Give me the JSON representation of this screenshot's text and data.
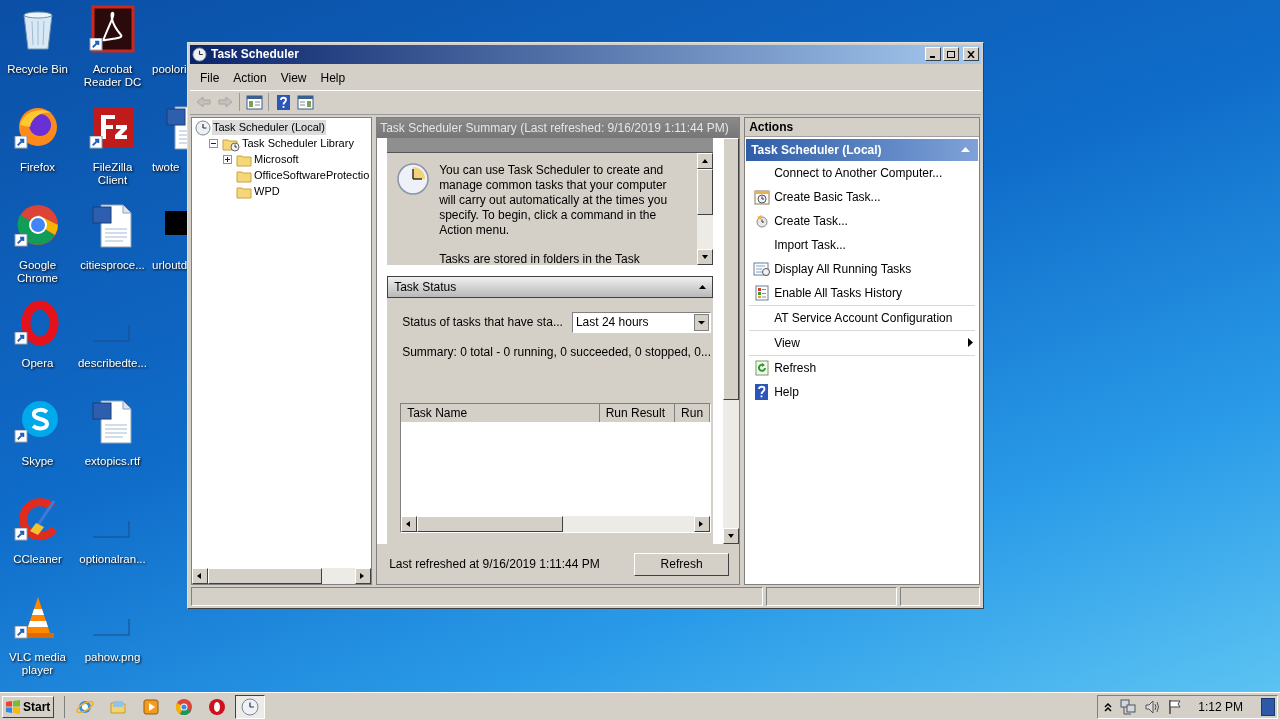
{
  "desktop": {
    "columns": [
      {
        "icons": [
          {
            "label": "Recycle Bin",
            "kind": "recycle-bin",
            "shortcut": false
          },
          {
            "label": "Firefox",
            "kind": "firefox",
            "shortcut": true
          },
          {
            "label": "Google Chrome",
            "kind": "chrome",
            "shortcut": true
          },
          {
            "label": "Opera",
            "kind": "opera",
            "shortcut": true
          },
          {
            "label": "Skype",
            "kind": "skype",
            "shortcut": true
          },
          {
            "label": "CCleaner",
            "kind": "ccleaner",
            "shortcut": true
          },
          {
            "label": "VLC media player",
            "kind": "vlc",
            "shortcut": true
          }
        ]
      },
      {
        "icons": [
          {
            "label": "Acrobat Reader DC",
            "kind": "pdf",
            "shortcut": true
          },
          {
            "label": "FileZilla Client",
            "kind": "filezilla",
            "shortcut": true
          },
          {
            "label": "citiesproce...",
            "kind": "word",
            "shortcut": false
          },
          {
            "label": "describedte...",
            "kind": "image",
            "shortcut": false
          },
          {
            "label": "extopics.rtf",
            "kind": "word",
            "shortcut": false
          },
          {
            "label": "optionalran...",
            "kind": "image",
            "shortcut": false
          },
          {
            "label": "pahow.png",
            "kind": "image",
            "shortcut": false
          }
        ]
      },
      {
        "icons": [
          {
            "label": "poolori",
            "kind": "none",
            "shortcut": false
          },
          {
            "label": "twote",
            "kind": "word",
            "shortcut": false
          },
          {
            "label": "urloutd",
            "kind": "black-file",
            "shortcut": false
          }
        ]
      }
    ]
  },
  "window": {
    "title": "Task Scheduler",
    "menu": [
      "File",
      "Action",
      "View",
      "Help"
    ],
    "toolbar": [
      {
        "kind": "back",
        "disabled": true
      },
      {
        "kind": "forward",
        "disabled": true
      },
      {
        "kind": "console-tree",
        "disabled": false
      },
      {
        "kind": "help",
        "disabled": false
      },
      {
        "kind": "action-pane",
        "disabled": false
      }
    ],
    "tree": [
      {
        "label": "Task Scheduler (Local)",
        "kind": "clock",
        "selected": true,
        "children": [
          {
            "label": "Task Scheduler Library",
            "kind": "library",
            "selected": false,
            "expanded": true,
            "children": [
              {
                "label": "Microsoft",
                "kind": "folder",
                "selected": false,
                "expanded": false
              },
              {
                "label": "OfficeSoftwareProtectio",
                "kind": "folder",
                "selected": false
              },
              {
                "label": "WPD",
                "kind": "folder",
                "selected": false
              }
            ]
          }
        ]
      }
    ],
    "summary": {
      "header": "Task Scheduler Summary (Last refreshed: 9/16/2019 1:11:44 PM)",
      "overview": [
        "You can use Task Scheduler to create and manage common tasks that your computer will carry out automatically at the times you specify. To begin, click a command in the Action menu.",
        "Tasks are stored in folders in the Task"
      ]
    },
    "task_status": {
      "title": "Task Status",
      "expanded": true,
      "filter_label": "Status of tasks that have sta...",
      "filter_value": "Last 24 hours",
      "summary": "Summary: 0 total - 0 running, 0 succeeded, 0 stopped, 0...",
      "columns": [
        "Task Name",
        "Run Result",
        "Run"
      ]
    },
    "footer": {
      "text": "Last refreshed at 9/16/2019 1:11:44 PM",
      "button": "Refresh"
    },
    "actions": {
      "title": "Actions",
      "group": {
        "title": "Task Scheduler (Local)",
        "expanded": true
      },
      "items": [
        {
          "kind": "plain",
          "label": "Connect to Another Computer..."
        },
        {
          "kind": "basic-task",
          "label": "Create Basic Task..."
        },
        {
          "kind": "task",
          "label": "Create Task..."
        },
        {
          "kind": "plain",
          "label": "Import Task..."
        },
        {
          "kind": "running",
          "label": "Display All Running Tasks"
        },
        {
          "kind": "history",
          "label": "Enable All Tasks History"
        },
        {
          "kind": "separator"
        },
        {
          "kind": "plain",
          "label": "AT Service Account Configuration"
        },
        {
          "kind": "separator"
        },
        {
          "kind": "submenu",
          "label": "View"
        },
        {
          "kind": "separator"
        },
        {
          "kind": "refresh",
          "label": "Refresh"
        },
        {
          "kind": "help",
          "label": "Help"
        }
      ]
    }
  },
  "taskbar": {
    "start": "Start",
    "apps": [
      {
        "kind": "ie",
        "active": false
      },
      {
        "kind": "folder",
        "active": false
      },
      {
        "kind": "media",
        "active": false
      },
      {
        "kind": "chrome",
        "active": false
      },
      {
        "kind": "opera",
        "active": false
      },
      {
        "kind": "task-scheduler",
        "active": true
      }
    ],
    "clock": "1:12 PM"
  }
}
